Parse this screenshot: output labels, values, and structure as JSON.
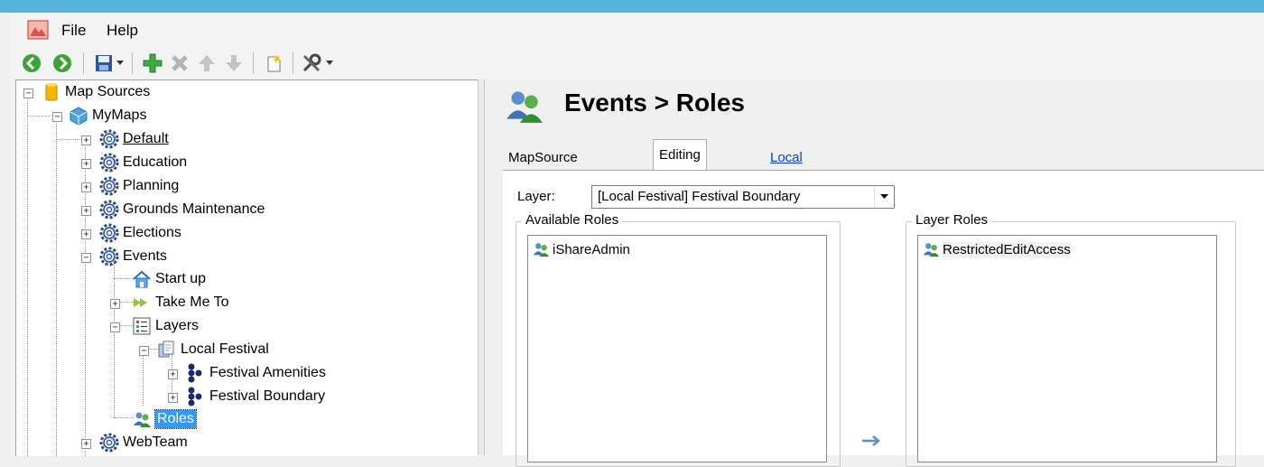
{
  "menu": {
    "items": [
      "File",
      "Help"
    ]
  },
  "toolbar": {
    "buttons": [
      "back-icon",
      "forward-icon",
      "save-icon",
      "save-dropdown-icon",
      "add-icon",
      "delete-icon",
      "move-up-icon",
      "move-down-icon",
      "new-item-icon",
      "tools-icon",
      "tools-dropdown-icon"
    ]
  },
  "tree": {
    "nodes": [
      "Map Sources",
      "MyMaps",
      "Default",
      "Education",
      "Planning",
      "Grounds Maintenance",
      "Elections",
      "Events",
      "Start up",
      "Take Me To",
      "Layers",
      "Local Festival",
      "Festival Amenities",
      "Festival Boundary",
      "Roles",
      "WebTeam"
    ]
  },
  "header": {
    "title": "Events > Roles"
  },
  "tabs": [
    "MapSource Access",
    "Editing Rights",
    "Local Users and Groups"
  ],
  "layer": {
    "label": "Layer:",
    "value": "[Local Festival] Festival Boundary"
  },
  "available_roles": {
    "title": "Available Roles",
    "items": [
      "iShareAdmin"
    ]
  },
  "layer_roles": {
    "title": "Layer Roles",
    "items": [
      "RestrictedEditAccess"
    ]
  },
  "colors": {
    "titlebar": "#56b4dc",
    "selection": "#3399ff",
    "link": "#0645c8"
  }
}
